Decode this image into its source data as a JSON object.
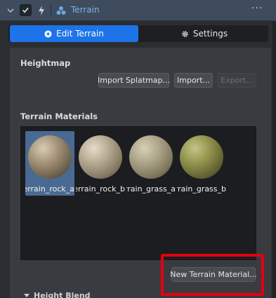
{
  "header": {
    "title": "Terrain",
    "more_label": "···",
    "enabled": true,
    "accent_color": "#7eb3ea"
  },
  "tabs": [
    {
      "label": "Edit Terrain",
      "icon": "edit-icon",
      "active": true
    },
    {
      "label": "Settings",
      "icon": "gear-icon",
      "active": false
    }
  ],
  "heightmap": {
    "label": "Heightmap",
    "import_splatmap_label": "Import Splatmap...",
    "import_label": "Import...",
    "export_label": "Export..."
  },
  "terrain_materials": {
    "label": "Terrain Materials",
    "items": [
      {
        "label": "terrain_rock_a",
        "selected": true
      },
      {
        "label": "terrain_rock_b",
        "selected": false
      },
      {
        "label": "terrain_grass_a",
        "selected": false
      },
      {
        "label": "terrain_grass_b",
        "selected": false
      }
    ],
    "new_button_label": "New Terrain Material..."
  },
  "height_blend": {
    "label": "Height Blend"
  }
}
